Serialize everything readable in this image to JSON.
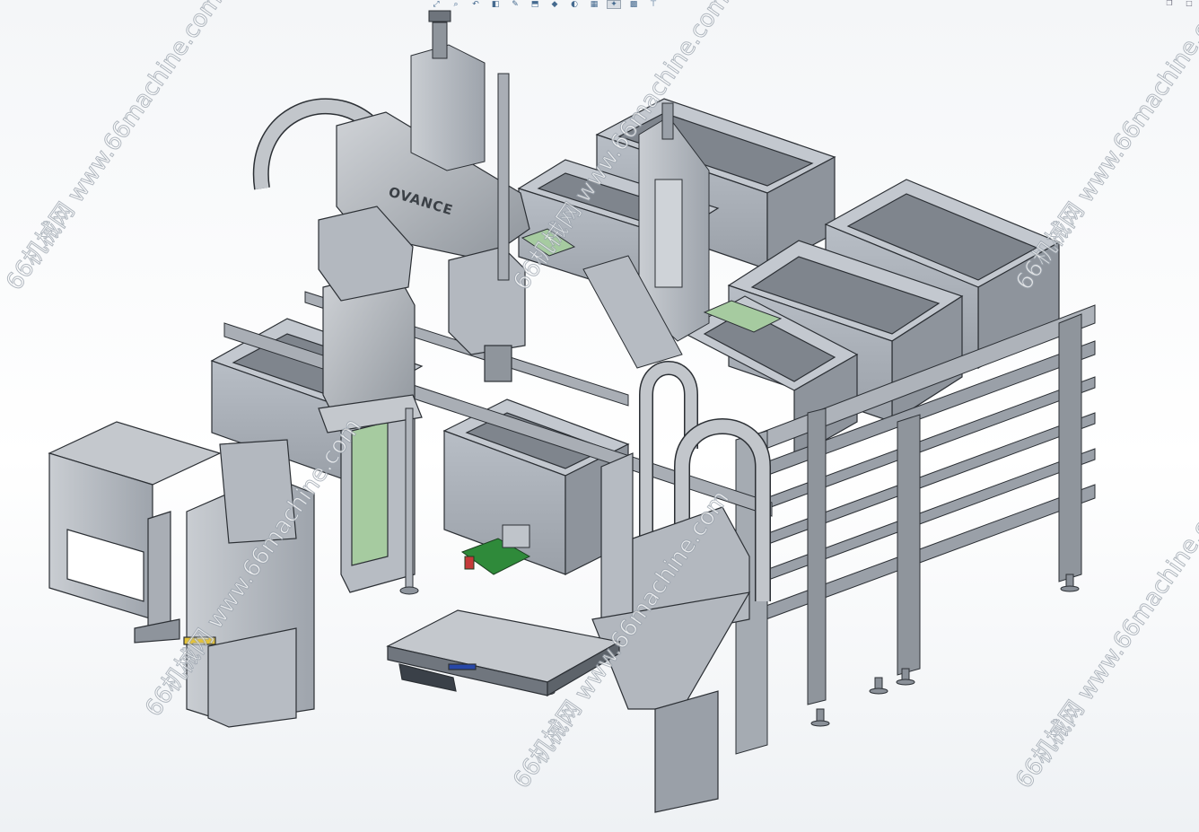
{
  "toolbar": {
    "items": [
      {
        "icon": "zoom-to-fit-icon",
        "glyph": "⤢"
      },
      {
        "icon": "zoom-area-icon",
        "glyph": "⌕"
      },
      {
        "icon": "previous-view-icon",
        "glyph": "↶"
      },
      {
        "icon": "section-view-icon",
        "glyph": "◧"
      },
      {
        "icon": "dynamic-annotation-icon",
        "glyph": "✎"
      },
      {
        "icon": "view-orientation-icon",
        "glyph": "⬒"
      },
      {
        "icon": "display-style-icon",
        "glyph": "◆"
      },
      {
        "icon": "hide-show-items-icon",
        "glyph": "◐"
      },
      {
        "icon": "edit-appearance-icon",
        "glyph": "▦"
      },
      {
        "icon": "apply-scene-icon",
        "glyph": "✦"
      },
      {
        "icon": "view-settings-icon",
        "glyph": "▩"
      },
      {
        "icon": "display-pane-icon",
        "glyph": "⊤"
      }
    ]
  },
  "window_controls": {
    "items": [
      {
        "icon": "restore-icon",
        "glyph": "❐"
      },
      {
        "icon": "close-icon",
        "glyph": "□"
      }
    ]
  },
  "model": {
    "robot_brand": "OVANCE"
  },
  "watermarks": [
    {
      "text": "66机械网 www.66machine.com"
    },
    {
      "text": "66机械网 www.66machine.com"
    },
    {
      "text": "66机械网 www.66machine.com"
    },
    {
      "text": "66机械网 www.66machine.com"
    },
    {
      "text": "66机械网 www.66machine.com"
    },
    {
      "text": "66机械网 www.66machine.com"
    }
  ],
  "colors": {
    "metal": "#b9bec5",
    "metal_dark": "#7e858e",
    "bin": "#a9afb8",
    "bin_inner": "#8e949c",
    "green_part": "#a6cba0",
    "pcb_green": "#2f8a3a",
    "profile": "#9aa0a8"
  }
}
